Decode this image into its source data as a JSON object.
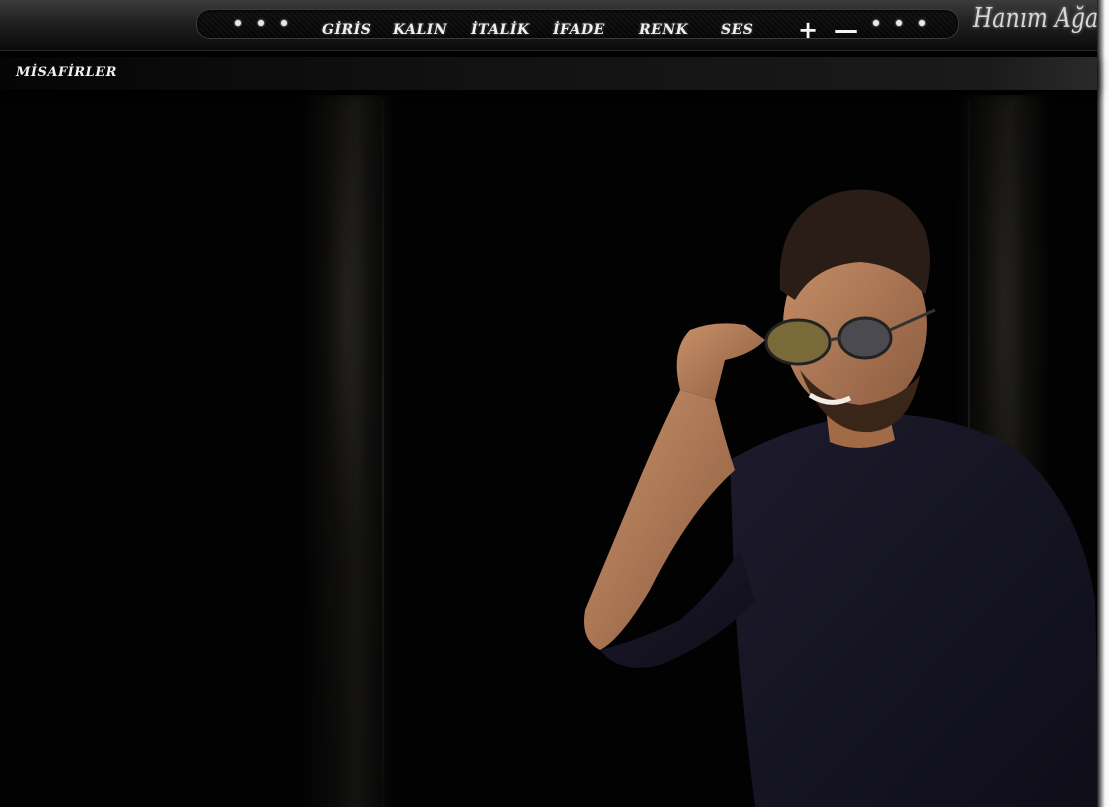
{
  "menu": {
    "items": [
      "GİRİS",
      "KALIN",
      "İTALİK",
      "İFADE",
      "RENK",
      "SES"
    ],
    "plus": "+",
    "minus": "—"
  },
  "logo": {
    "text": "Hanım Ağa"
  },
  "guests": {
    "title": "MİSAFİRLER"
  },
  "colors": {
    "background": "#020202",
    "text": "#f0f0f0",
    "bar": "#202020"
  },
  "icons": [
    "dot-icon",
    "plus-icon",
    "minus-icon"
  ]
}
